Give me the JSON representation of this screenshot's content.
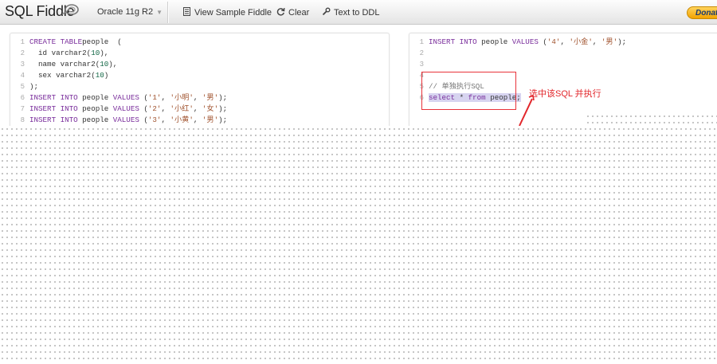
{
  "toolbar": {
    "brand": "SQL Fiddle",
    "db_select": "Oracle 11g R2",
    "view_sample": "View Sample Fiddle",
    "clear": "Clear",
    "text_to_ddl": "Text to DDL",
    "donate": "Donat"
  },
  "schema_panel": {
    "lines": [
      {
        "n": "1",
        "parts": [
          [
            "kw",
            "CREATE TABLE"
          ],
          [
            "",
            "people  ("
          ]
        ]
      },
      {
        "n": "2",
        "parts": [
          [
            "",
            "  id varchar2("
          ],
          [
            "num",
            "10"
          ],
          [
            "",
            "),"
          ]
        ]
      },
      {
        "n": "3",
        "parts": [
          [
            "",
            "  name varchar2("
          ],
          [
            "num",
            "10"
          ],
          [
            "",
            "),"
          ]
        ]
      },
      {
        "n": "4",
        "parts": [
          [
            "",
            "  sex varchar2("
          ],
          [
            "num",
            "10"
          ],
          [
            "",
            ")"
          ]
        ]
      },
      {
        "n": "5",
        "parts": [
          [
            "",
            ");"
          ]
        ]
      },
      {
        "n": "6",
        "parts": [
          [
            "kw",
            "INSERT INTO"
          ],
          [
            "",
            " people "
          ],
          [
            "kw",
            "VALUES"
          ],
          [
            "",
            " ("
          ],
          [
            "str",
            "'1'"
          ],
          [
            "",
            ", "
          ],
          [
            "str",
            "'小明'"
          ],
          [
            "",
            ", "
          ],
          [
            "str",
            "'男'"
          ],
          [
            "",
            ");"
          ]
        ]
      },
      {
        "n": "7",
        "parts": [
          [
            "kw",
            "INSERT INTO"
          ],
          [
            "",
            " people "
          ],
          [
            "kw",
            "VALUES"
          ],
          [
            "",
            " ("
          ],
          [
            "str",
            "'2'"
          ],
          [
            "",
            ", "
          ],
          [
            "str",
            "'小红'"
          ],
          [
            "",
            ", "
          ],
          [
            "str",
            "'女'"
          ],
          [
            "",
            ");"
          ]
        ]
      },
      {
        "n": "8",
        "parts": [
          [
            "kw",
            "INSERT INTO"
          ],
          [
            "",
            " people "
          ],
          [
            "kw",
            "VALUES"
          ],
          [
            "",
            " ("
          ],
          [
            "str",
            "'3'"
          ],
          [
            "",
            ", "
          ],
          [
            "str",
            "'小黄'"
          ],
          [
            "",
            ", "
          ],
          [
            "str",
            "'男'"
          ],
          [
            "",
            ");"
          ]
        ]
      }
    ]
  },
  "query_panel": {
    "lines": [
      {
        "n": "1",
        "parts": [
          [
            "kw",
            "INSERT INTO"
          ],
          [
            "",
            " people "
          ],
          [
            "kw",
            "VALUES"
          ],
          [
            "",
            " ("
          ],
          [
            "str",
            "'4'"
          ],
          [
            "",
            ", "
          ],
          [
            "str",
            "'小金'"
          ],
          [
            "",
            ", "
          ],
          [
            "str",
            "'男'"
          ],
          [
            "",
            ");"
          ]
        ]
      },
      {
        "n": "2",
        "parts": []
      },
      {
        "n": "3",
        "parts": []
      },
      {
        "n": "4",
        "parts": []
      },
      {
        "n": "5",
        "parts": [
          [
            "cmt",
            "// 单独执行SQL"
          ]
        ]
      },
      {
        "n": "6",
        "parts": [
          [
            "kw sel",
            "select"
          ],
          [
            "sel",
            " * "
          ],
          [
            "kw sel",
            "from"
          ],
          [
            "sel",
            " people;"
          ]
        ]
      }
    ]
  },
  "annotation": {
    "text": "选中该SQL 并执行",
    "color": "#e2262b"
  }
}
